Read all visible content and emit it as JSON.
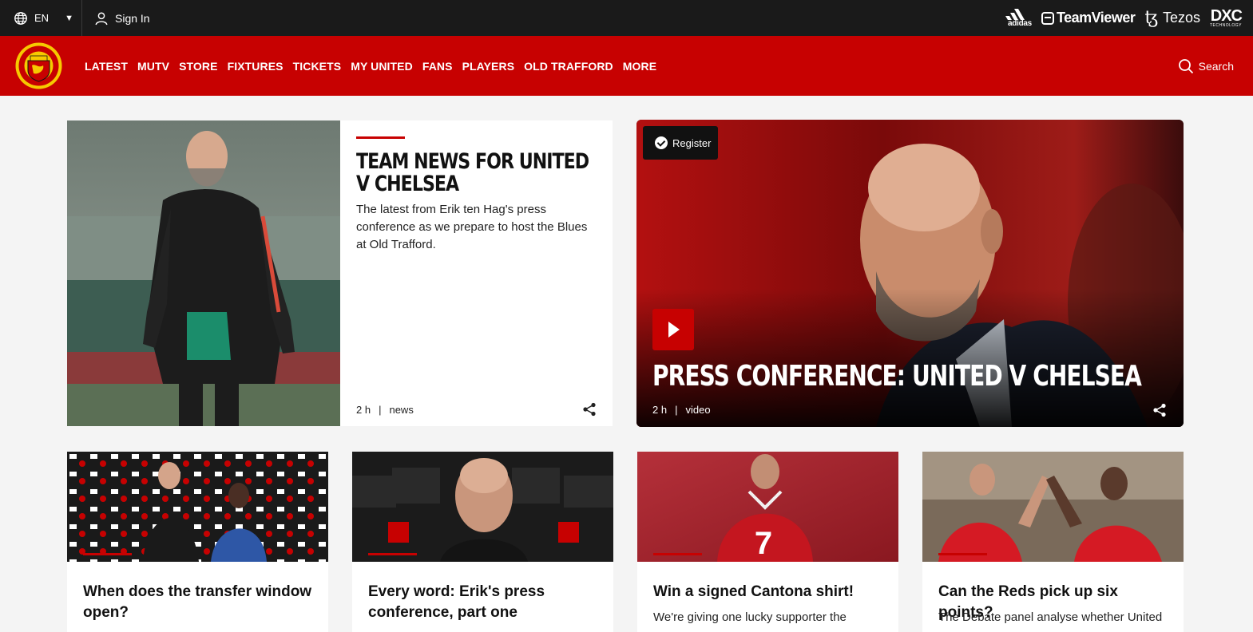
{
  "topbar": {
    "language": "EN",
    "sign_in": "Sign In",
    "sponsors": {
      "adidas": "adidas",
      "teamviewer": "TeamViewer",
      "tezos": "Tezos",
      "dxc": "DXC",
      "dxc_sub": "TECHNOLOGY"
    }
  },
  "nav": {
    "items": [
      "LATEST",
      "MUTV",
      "STORE",
      "FIXTURES",
      "TICKETS",
      "MY UNITED",
      "FANS",
      "PLAYERS",
      "OLD TRAFFORD",
      "MORE"
    ],
    "search": "Search"
  },
  "colors": {
    "brand_red": "#c70101",
    "topbar": "#1a1a1a"
  },
  "feature": {
    "headline": "TEAM NEWS FOR UNITED V CHELSEA",
    "description": "The latest from Erik ten Hag's press conference as we prepare to host the Blues at Old Trafford.",
    "time": "2 h",
    "separator": "|",
    "category": "news"
  },
  "video": {
    "register": "Register",
    "headline": "PRESS CONFERENCE: UNITED V CHELSEA",
    "time": "2 h",
    "separator": "|",
    "category": "video"
  },
  "cards": [
    {
      "title": "When does the transfer window open?",
      "subtitle": ""
    },
    {
      "title": "Every word: Erik's press conference, part one",
      "subtitle": ""
    },
    {
      "title": "Win a signed Cantona shirt!",
      "subtitle": "We're giving one lucky supporter the"
    },
    {
      "title": "Can the Reds pick up six points?",
      "subtitle": "The Debate panel analyse whether United"
    }
  ]
}
